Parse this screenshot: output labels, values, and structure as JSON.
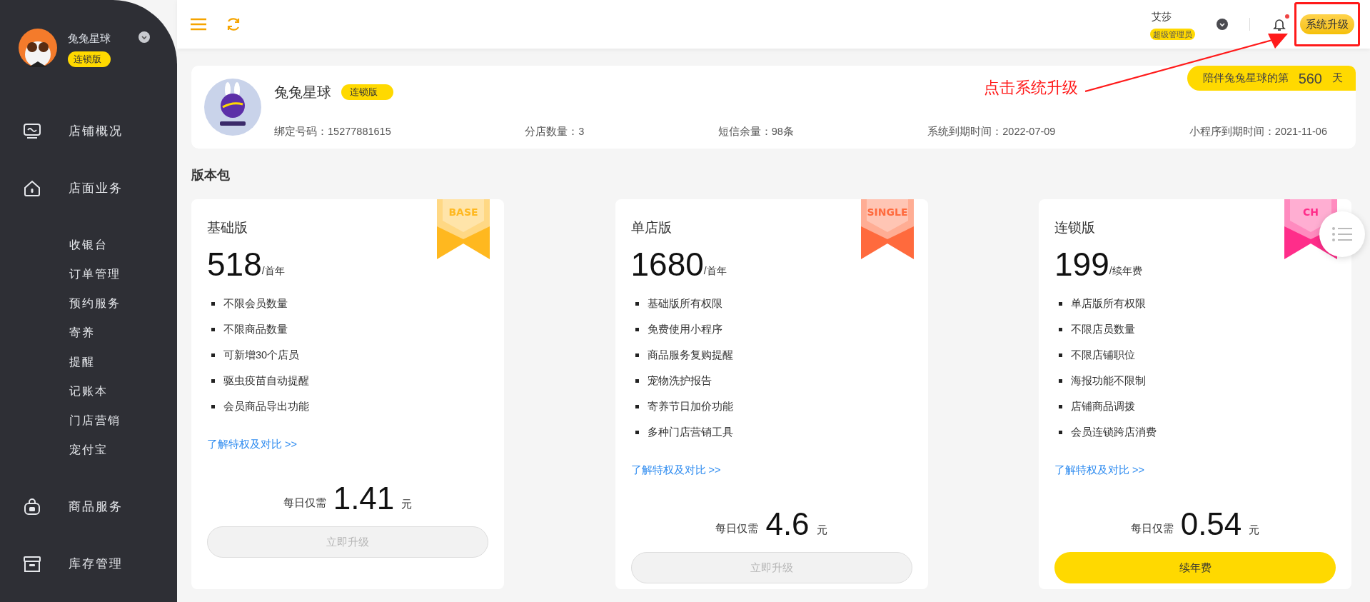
{
  "sidebar": {
    "store_name": "兔兔星球",
    "edition_badge": "连锁版",
    "items": [
      {
        "label": "店铺概况",
        "kind": "monitor",
        "selected": false
      },
      {
        "label": "店面业务",
        "kind": "home",
        "selected": false,
        "children": [
          {
            "label": "收银台"
          },
          {
            "label": "订单管理"
          },
          {
            "label": "预约服务"
          },
          {
            "label": "寄养"
          },
          {
            "label": "提醒"
          },
          {
            "label": "记账本"
          },
          {
            "label": "门店营销"
          },
          {
            "label": "宠付宝"
          }
        ]
      },
      {
        "label": "商品服务",
        "kind": "bag",
        "selected": false
      },
      {
        "label": "库存管理",
        "kind": "box",
        "selected": false
      }
    ]
  },
  "header": {
    "user_name": "艾莎",
    "user_role": "超级管理员",
    "has_notification": true,
    "upgrade_button": "系统升级"
  },
  "annotation": {
    "text": "点击系统升级"
  },
  "store_card": {
    "name": "兔兔星球",
    "edition_badge": "连锁版",
    "days_banner": {
      "prefix": "陪伴兔兔星球的第",
      "days": "560",
      "suffix": "天"
    },
    "fields": [
      {
        "label": "绑定号码：",
        "value": "15277881615"
      },
      {
        "label": "分店数量：",
        "value": "3"
      },
      {
        "label": "短信余量：",
        "value": "98条"
      },
      {
        "label": "系统到期时间：",
        "value": "2022-07-09"
      },
      {
        "label": "小程序到期时间：",
        "value": "2021-11-06"
      }
    ]
  },
  "section_title": "版本包",
  "packages": [
    {
      "title": "基础版",
      "ribbon": "BASE",
      "color": "#ffb81f",
      "price": "518",
      "unit": "/首年",
      "features": [
        "不限会员数量",
        "不限商品数量",
        "可新增30个店员",
        "驱虫疫苗自动提醒",
        "会员商品导出功能"
      ],
      "link": "了解特权及对比 >>",
      "daily_prefix": "每日仅需",
      "daily_price": "1.41",
      "daily_suffix": "元",
      "button": "立即升级",
      "disabled": true
    },
    {
      "title": "单店版",
      "ribbon": "SINGLE",
      "color": "#ff6a3d",
      "price": "1680",
      "unit": "/首年",
      "features": [
        "基础版所有权限",
        "免费使用小程序",
        "商品服务复购提醒",
        "宠物洗护报告",
        "寄养节日加价功能",
        "多种门店营销工具"
      ],
      "link": "了解特权及对比 >>",
      "daily_prefix": "每日仅需",
      "daily_price": "4.6",
      "daily_suffix": "元",
      "button": "立即升级",
      "disabled": true
    },
    {
      "title": "连锁版",
      "ribbon": "CH",
      "color": "#ff2d8a",
      "price": "199",
      "unit": "/续年费",
      "features": [
        "单店版所有权限",
        "不限店员数量",
        "不限店铺职位",
        "海报功能不限制",
        "店铺商品调拨",
        "会员连锁跨店消费"
      ],
      "link": "了解特权及对比 >>",
      "daily_prefix": "每日仅需",
      "daily_price": "0.54",
      "daily_suffix": "元",
      "button": "续年费",
      "disabled": false
    }
  ]
}
